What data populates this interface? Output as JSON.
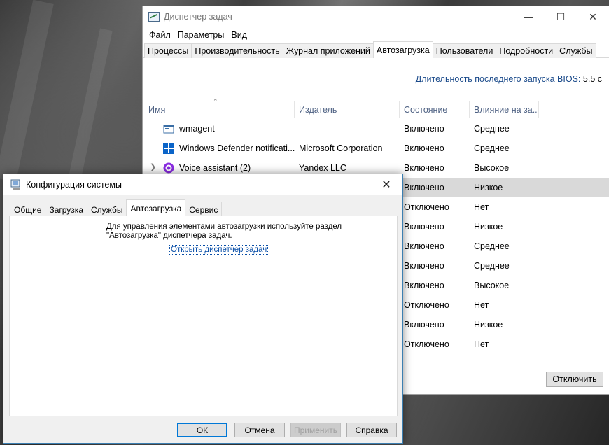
{
  "task_manager": {
    "title": "Диспетчер задач",
    "menu": [
      "Файл",
      "Параметры",
      "Вид"
    ],
    "tabs": [
      "Процессы",
      "Производительность",
      "Журнал приложений",
      "Автозагрузка",
      "Пользователи",
      "Подробности",
      "Службы"
    ],
    "active_tab": "Автозагрузка",
    "bios_label": "Длительность последнего запуска BIOS:",
    "bios_value": "5.5 с",
    "columns": {
      "name": "Имя",
      "publisher": "Издатель",
      "status": "Состояние",
      "impact": "Влияние на за..."
    },
    "rows": [
      {
        "name": "wmagent",
        "publisher": "",
        "status": "Включено",
        "impact": "Среднее",
        "icon": "window-app-icon"
      },
      {
        "name": "Windows Defender notificati...",
        "publisher": "Microsoft Corporation",
        "status": "Включено",
        "impact": "Среднее",
        "icon": "defender-shield-icon"
      },
      {
        "name": "Voice assistant (2)",
        "publisher": "Yandex LLC",
        "status": "Включено",
        "impact": "Высокое",
        "icon": "alice-icon"
      },
      {
        "name": "",
        "publisher": "",
        "status": "Включено",
        "impact": "Низкое"
      },
      {
        "name": "",
        "publisher": "",
        "status": "Отключено",
        "impact": "Нет"
      },
      {
        "name": "",
        "publisher": "",
        "status": "Включено",
        "impact": "Низкое"
      },
      {
        "name": "",
        "publisher": "",
        "status": "Включено",
        "impact": "Среднее"
      },
      {
        "name": "",
        "publisher": "",
        "status": "Включено",
        "impact": "Среднее"
      },
      {
        "name": "",
        "publisher": "",
        "status": "Включено",
        "impact": "Высокое"
      },
      {
        "name": "",
        "publisher": "",
        "status": "Отключено",
        "impact": "Нет"
      },
      {
        "name": "",
        "publisher": "",
        "status": "Включено",
        "impact": "Низкое"
      },
      {
        "name": "",
        "publisher": "",
        "status": "Отключено",
        "impact": "Нет"
      }
    ],
    "disable_button": "Отключить"
  },
  "msconfig": {
    "title": "Конфигурация системы",
    "tabs": [
      "Общие",
      "Загрузка",
      "Службы",
      "Автозагрузка",
      "Сервис"
    ],
    "active_tab": "Автозагрузка",
    "message_line1": "Для управления элементами автозагрузки используйте раздел",
    "message_line2": "\"Автозагрузка\" диспетчера задач.",
    "link": "Открыть диспетчер задач",
    "buttons": {
      "ok": "ОК",
      "cancel": "Отмена",
      "apply": "Применить",
      "help": "Справка"
    }
  }
}
